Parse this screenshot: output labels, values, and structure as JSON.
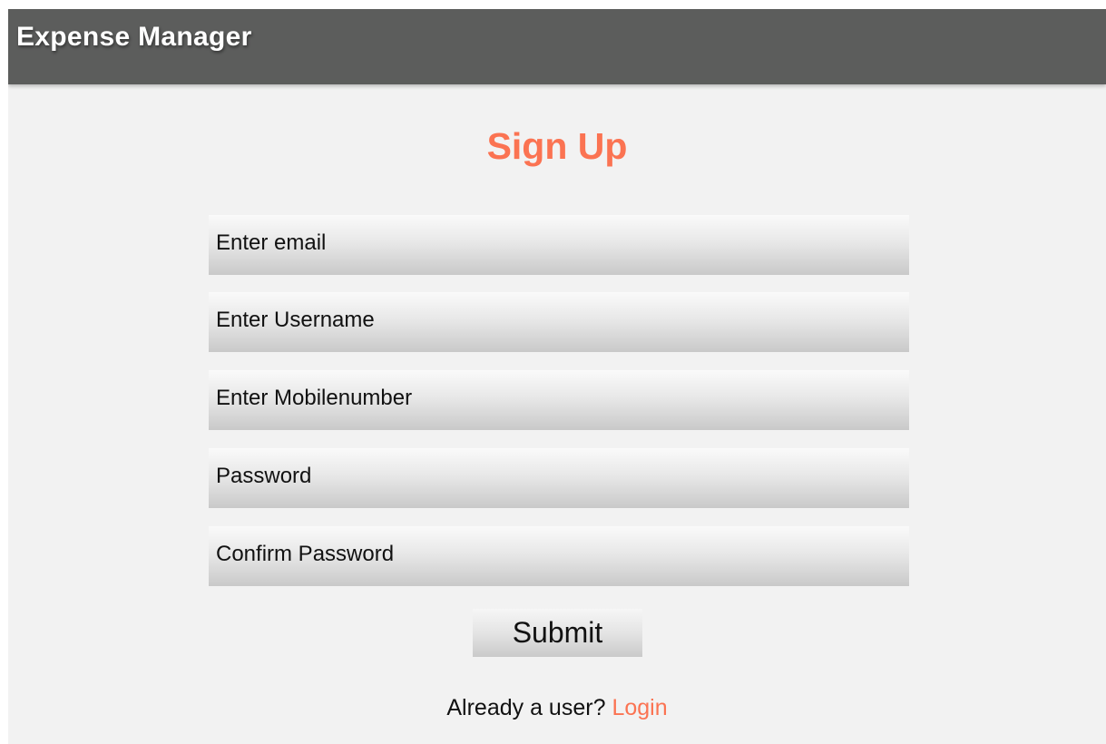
{
  "app_bar": {
    "title": "Expense Manager",
    "background_color": "#5c5d5c"
  },
  "form": {
    "heading": "Sign Up",
    "accent_color": "#fb7352",
    "fields": {
      "email": {
        "placeholder": "Enter email",
        "value": ""
      },
      "username": {
        "placeholder": "Enter Username",
        "value": ""
      },
      "mobile": {
        "placeholder": "Enter Mobilenumber",
        "value": ""
      },
      "password": {
        "placeholder": "Password",
        "value": ""
      },
      "confirm_password": {
        "placeholder": "Confirm Password",
        "value": ""
      }
    },
    "submit_label": "Submit"
  },
  "footer": {
    "prompt": "Already a user?",
    "login_label": "Login"
  }
}
